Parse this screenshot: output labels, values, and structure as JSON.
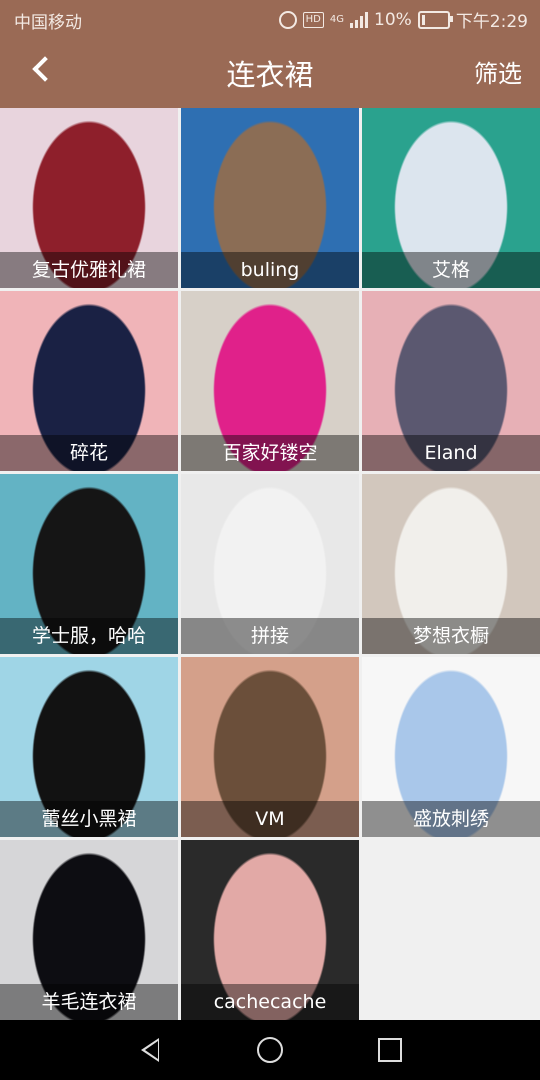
{
  "status_bar": {
    "carrier": "中国移动",
    "network": "4G",
    "battery": "10%",
    "time": "下午2:29"
  },
  "header": {
    "title": "连衣裙",
    "filter_label": "筛选"
  },
  "items": [
    {
      "caption": "复古优雅礼裙",
      "colors": [
        "#e8d4dd",
        "#8e1f2b"
      ]
    },
    {
      "caption": "buling",
      "colors": [
        "#2e6fb2",
        "#8b6d55"
      ]
    },
    {
      "caption": "艾格",
      "colors": [
        "#2aa28e",
        "#dce5ee"
      ]
    },
    {
      "caption": "碎花",
      "colors": [
        "#f0b4b8",
        "#1a2144"
      ]
    },
    {
      "caption": "百家好镂空",
      "colors": [
        "#d7d0c8",
        "#e0218a"
      ]
    },
    {
      "caption": "Eland",
      "colors": [
        "#e7b0b6",
        "#5b5870"
      ]
    },
    {
      "caption": "学士服，哈哈",
      "colors": [
        "#63b3c4",
        "#151515"
      ]
    },
    {
      "caption": "拼接",
      "colors": [
        "#e8e8e8",
        "#f2f2f2"
      ]
    },
    {
      "caption": "梦想衣橱",
      "colors": [
        "#d2c7bd",
        "#f1efeb"
      ]
    },
    {
      "caption": "蕾丝小黑裙",
      "colors": [
        "#9fd5e6",
        "#121212"
      ]
    },
    {
      "caption": "VM",
      "colors": [
        "#d4a08a",
        "#6b4f3a"
      ]
    },
    {
      "caption": "盛放刺绣",
      "colors": [
        "#f7f7f7",
        "#a9c7ea"
      ]
    },
    {
      "caption": "羊毛连衣裙",
      "colors": [
        "#d6d6d8",
        "#0d0d12"
      ]
    },
    {
      "caption": "cachecache",
      "colors": [
        "#2a2a2a",
        "#e2a9a6"
      ]
    }
  ]
}
